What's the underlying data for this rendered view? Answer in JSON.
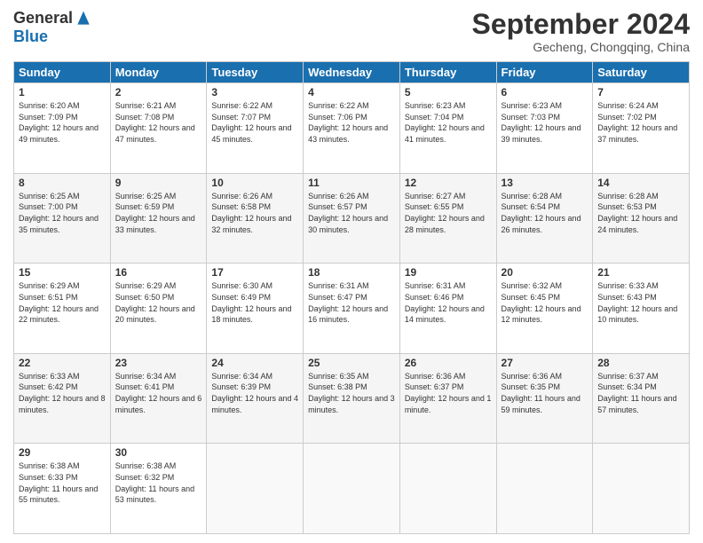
{
  "logo": {
    "general": "General",
    "blue": "Blue"
  },
  "title": "September 2024",
  "location": "Gecheng, Chongqing, China",
  "days_header": [
    "Sunday",
    "Monday",
    "Tuesday",
    "Wednesday",
    "Thursday",
    "Friday",
    "Saturday"
  ],
  "weeks": [
    [
      {
        "day": "1",
        "sunrise": "6:20 AM",
        "sunset": "7:09 PM",
        "daylight": "12 hours and 49 minutes."
      },
      {
        "day": "2",
        "sunrise": "6:21 AM",
        "sunset": "7:08 PM",
        "daylight": "12 hours and 47 minutes."
      },
      {
        "day": "3",
        "sunrise": "6:22 AM",
        "sunset": "7:07 PM",
        "daylight": "12 hours and 45 minutes."
      },
      {
        "day": "4",
        "sunrise": "6:22 AM",
        "sunset": "7:06 PM",
        "daylight": "12 hours and 43 minutes."
      },
      {
        "day": "5",
        "sunrise": "6:23 AM",
        "sunset": "7:04 PM",
        "daylight": "12 hours and 41 minutes."
      },
      {
        "day": "6",
        "sunrise": "6:23 AM",
        "sunset": "7:03 PM",
        "daylight": "12 hours and 39 minutes."
      },
      {
        "day": "7",
        "sunrise": "6:24 AM",
        "sunset": "7:02 PM",
        "daylight": "12 hours and 37 minutes."
      }
    ],
    [
      {
        "day": "8",
        "sunrise": "6:25 AM",
        "sunset": "7:00 PM",
        "daylight": "12 hours and 35 minutes."
      },
      {
        "day": "9",
        "sunrise": "6:25 AM",
        "sunset": "6:59 PM",
        "daylight": "12 hours and 33 minutes."
      },
      {
        "day": "10",
        "sunrise": "6:26 AM",
        "sunset": "6:58 PM",
        "daylight": "12 hours and 32 minutes."
      },
      {
        "day": "11",
        "sunrise": "6:26 AM",
        "sunset": "6:57 PM",
        "daylight": "12 hours and 30 minutes."
      },
      {
        "day": "12",
        "sunrise": "6:27 AM",
        "sunset": "6:55 PM",
        "daylight": "12 hours and 28 minutes."
      },
      {
        "day": "13",
        "sunrise": "6:28 AM",
        "sunset": "6:54 PM",
        "daylight": "12 hours and 26 minutes."
      },
      {
        "day": "14",
        "sunrise": "6:28 AM",
        "sunset": "6:53 PM",
        "daylight": "12 hours and 24 minutes."
      }
    ],
    [
      {
        "day": "15",
        "sunrise": "6:29 AM",
        "sunset": "6:51 PM",
        "daylight": "12 hours and 22 minutes."
      },
      {
        "day": "16",
        "sunrise": "6:29 AM",
        "sunset": "6:50 PM",
        "daylight": "12 hours and 20 minutes."
      },
      {
        "day": "17",
        "sunrise": "6:30 AM",
        "sunset": "6:49 PM",
        "daylight": "12 hours and 18 minutes."
      },
      {
        "day": "18",
        "sunrise": "6:31 AM",
        "sunset": "6:47 PM",
        "daylight": "12 hours and 16 minutes."
      },
      {
        "day": "19",
        "sunrise": "6:31 AM",
        "sunset": "6:46 PM",
        "daylight": "12 hours and 14 minutes."
      },
      {
        "day": "20",
        "sunrise": "6:32 AM",
        "sunset": "6:45 PM",
        "daylight": "12 hours and 12 minutes."
      },
      {
        "day": "21",
        "sunrise": "6:33 AM",
        "sunset": "6:43 PM",
        "daylight": "12 hours and 10 minutes."
      }
    ],
    [
      {
        "day": "22",
        "sunrise": "6:33 AM",
        "sunset": "6:42 PM",
        "daylight": "12 hours and 8 minutes."
      },
      {
        "day": "23",
        "sunrise": "6:34 AM",
        "sunset": "6:41 PM",
        "daylight": "12 hours and 6 minutes."
      },
      {
        "day": "24",
        "sunrise": "6:34 AM",
        "sunset": "6:39 PM",
        "daylight": "12 hours and 4 minutes."
      },
      {
        "day": "25",
        "sunrise": "6:35 AM",
        "sunset": "6:38 PM",
        "daylight": "12 hours and 3 minutes."
      },
      {
        "day": "26",
        "sunrise": "6:36 AM",
        "sunset": "6:37 PM",
        "daylight": "12 hours and 1 minute."
      },
      {
        "day": "27",
        "sunrise": "6:36 AM",
        "sunset": "6:35 PM",
        "daylight": "11 hours and 59 minutes."
      },
      {
        "day": "28",
        "sunrise": "6:37 AM",
        "sunset": "6:34 PM",
        "daylight": "11 hours and 57 minutes."
      }
    ],
    [
      {
        "day": "29",
        "sunrise": "6:38 AM",
        "sunset": "6:33 PM",
        "daylight": "11 hours and 55 minutes."
      },
      {
        "day": "30",
        "sunrise": "6:38 AM",
        "sunset": "6:32 PM",
        "daylight": "11 hours and 53 minutes."
      },
      null,
      null,
      null,
      null,
      null
    ]
  ]
}
